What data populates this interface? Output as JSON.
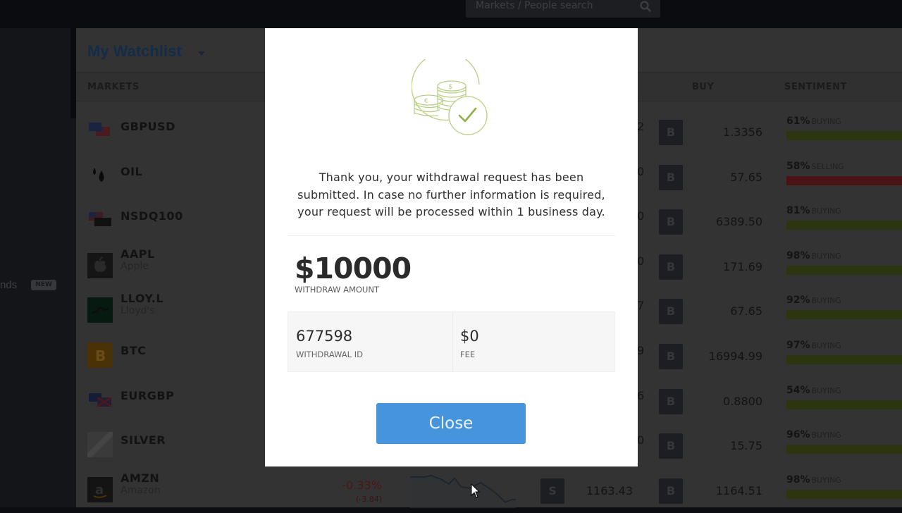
{
  "topbar": {
    "search_placeholder": "Markets / People search",
    "search_icon": "search-icon"
  },
  "leftnav": {
    "partial_label": "nds",
    "new_badge": "NEW"
  },
  "watchlist": {
    "title": "My Watchlist",
    "columns": {
      "markets": "MARKETS",
      "buy": "BUY",
      "sentiment": "SENTIMENT"
    },
    "rows": [
      {
        "symbol": "GBPUSD",
        "subtitle": "",
        "icon": "gbp-usd-flag-icon",
        "sell_partial": "2",
        "buy_label": "B",
        "buy_price": "1.3356",
        "sentiment_pct": "61%",
        "sentiment_word": "BUYING",
        "sentiment_color": "#2c3510"
      },
      {
        "symbol": "OIL",
        "subtitle": "",
        "icon": "oil-drop-icon",
        "sell_partial": "0",
        "buy_label": "B",
        "buy_price": "57.65",
        "sentiment_pct": "58%",
        "sentiment_word": "SELLING",
        "sentiment_color": "#4a1414"
      },
      {
        "symbol": "NSDQ100",
        "subtitle": "",
        "icon": "usa-flag-icon",
        "sell_partial": "0",
        "buy_label": "B",
        "buy_price": "6389.50",
        "sentiment_pct": "81%",
        "sentiment_word": "BUYING",
        "sentiment_color": "#2c3510"
      },
      {
        "symbol": "AAPL",
        "subtitle": "Apple",
        "icon": "apple-logo-icon",
        "sell_partial": "0",
        "buy_label": "B",
        "buy_price": "171.69",
        "sentiment_pct": "98%",
        "sentiment_word": "BUYING",
        "sentiment_color": "#2c3510"
      },
      {
        "symbol": "LLOY.L",
        "subtitle": "Lloyd's",
        "icon": "lloyds-logo-icon",
        "sell_partial": "7",
        "buy_label": "B",
        "buy_price": "67.65",
        "sentiment_pct": "92%",
        "sentiment_word": "BUYING",
        "sentiment_color": "#2c3510"
      },
      {
        "symbol": "BTC",
        "subtitle": "",
        "icon": "bitcoin-icon",
        "sell_partial": "9",
        "buy_label": "B",
        "buy_price": "16994.99",
        "sentiment_pct": "97%",
        "sentiment_word": "BUYING",
        "sentiment_color": "#2c3510"
      },
      {
        "symbol": "EURGBP",
        "subtitle": "",
        "icon": "eur-gbp-flag-icon",
        "sell_partial": "6",
        "buy_label": "B",
        "buy_price": "0.8800",
        "sentiment_pct": "54%",
        "sentiment_word": "BUYING",
        "sentiment_color": "#2c3510"
      },
      {
        "symbol": "SILVER",
        "subtitle": "",
        "icon": "silver-bar-icon",
        "sell_partial": "0",
        "buy_label": "B",
        "buy_price": "15.75",
        "sentiment_pct": "96%",
        "sentiment_word": "BUYING",
        "sentiment_color": "#2c3510"
      },
      {
        "symbol": "AMZN",
        "subtitle": "Amazon",
        "icon": "amazon-logo-icon",
        "change_pct": "-0.33%",
        "change_abs": "(-3.84)",
        "sell_label": "S",
        "sell_price": "1163.43",
        "buy_label": "B",
        "buy_price": "1164.51",
        "sentiment_pct": "98%",
        "sentiment_word": "BUYING",
        "sentiment_color": "#2c3510"
      }
    ]
  },
  "modal": {
    "icon": "coins-check-icon",
    "message": "Thank you, your withdrawal request has been submitted. In case no further information is required, your request will be processed within 1 business day.",
    "amount": "$10000",
    "amount_label": "WITHDRAW AMOUNT",
    "withdrawal_id": "677598",
    "withdrawal_id_label": "WITHDRAWAL ID",
    "fee": "$0",
    "fee_label": "FEE",
    "close_label": "Close",
    "accent_color": "#4594dc",
    "icon_color": "#a9c46c"
  }
}
